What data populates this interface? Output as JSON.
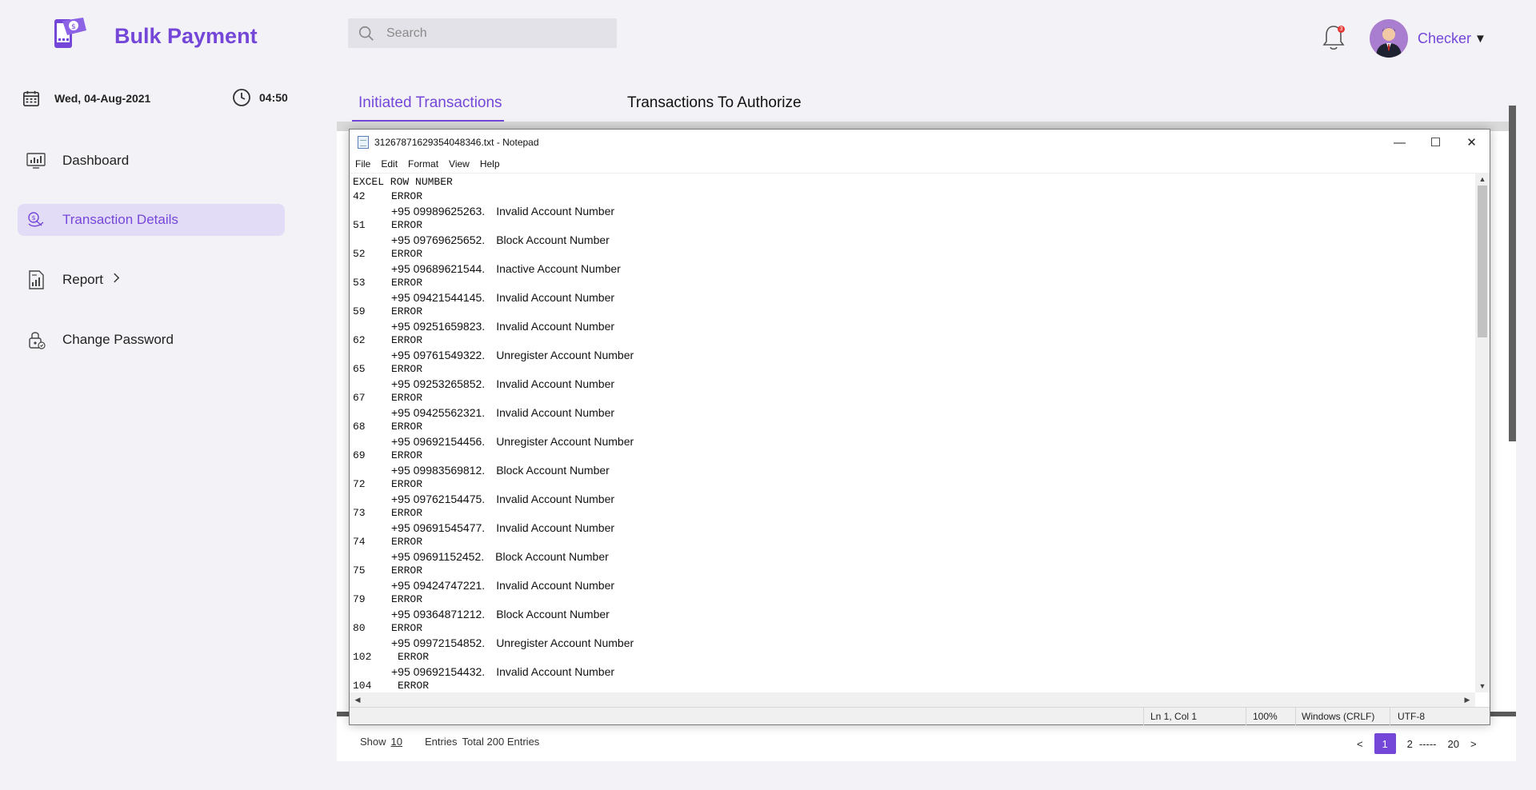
{
  "header": {
    "app_title": "Bulk Payment",
    "search_placeholder": "Search",
    "notification_count": "3",
    "user_name": "Checker"
  },
  "sidebar": {
    "date": "Wed, 04-Aug-2021",
    "time": "04:50",
    "items": [
      {
        "label": "Dashboard",
        "icon": "dashboard-icon"
      },
      {
        "label": "Transaction Details",
        "icon": "transaction-icon",
        "active": true
      },
      {
        "label": "Report",
        "icon": "report-icon",
        "chevron": ">"
      },
      {
        "label": "Change Password",
        "icon": "lock-icon"
      }
    ]
  },
  "tabs": [
    {
      "label": "Initiated Transactions",
      "active": true
    },
    {
      "label": "Transactions To Authorize",
      "active": false
    }
  ],
  "footer": {
    "show_label": "Show",
    "show_value": "10",
    "entries_label": "Entries",
    "total_label": "Total 200 Entries",
    "pager": {
      "prev": "<",
      "current": "1",
      "next_page": "2",
      "ellipsis": "-----",
      "last": "20",
      "next": ">"
    }
  },
  "notepad": {
    "title": "31267871629354048346.txt - Notepad",
    "menu": [
      "File",
      "Edit",
      "Format",
      "View",
      "Help"
    ],
    "header_line": "EXCEL ROW NUMBER",
    "rows": [
      {
        "row": "42",
        "status": "ERROR",
        "phone": "+95 09989625263.",
        "message": "Invalid Account Number"
      },
      {
        "row": "51",
        "status": "ERROR",
        "phone": "+95 09769625652.",
        "message": "Block Account Number"
      },
      {
        "row": "52",
        "status": "ERROR",
        "phone": "+95 09689621544.",
        "message": "Inactive Account Number"
      },
      {
        "row": "53",
        "status": "ERROR",
        "phone": "+95 09421544145.",
        "message": "Invalid Account Number"
      },
      {
        "row": "59",
        "status": "ERROR",
        "phone": "+95 09251659823.",
        "message": "Invalid Account Number"
      },
      {
        "row": "62",
        "status": "ERROR",
        "phone": "+95 09761549322.",
        "message": "Unregister Account Number"
      },
      {
        "row": "65",
        "status": "ERROR",
        "phone": "+95 09253265852.",
        "message": "Invalid Account Number"
      },
      {
        "row": "67",
        "status": "ERROR",
        "phone": "+95 09425562321.",
        "message": "Invalid Account Number"
      },
      {
        "row": "68",
        "status": "ERROR",
        "phone": "+95 09692154456.",
        "message": "Unregister Account Number"
      },
      {
        "row": "69",
        "status": "ERROR",
        "phone": "+95 09983569812.",
        "message": "Block Account Number"
      },
      {
        "row": "72",
        "status": "ERROR",
        "phone": "+95 09762154475.",
        "message": "Invalid Account Number"
      },
      {
        "row": "73",
        "status": "ERROR",
        "phone": "+95 09691545477.",
        "message": "Invalid Account Number"
      },
      {
        "row": "74",
        "status": "ERROR",
        "phone": "+95 09691152452.",
        "message": "Block Account Number"
      },
      {
        "row": "75",
        "status": "ERROR",
        "phone": "+95 09424747221.",
        "message": "Invalid Account Number"
      },
      {
        "row": "79",
        "status": "ERROR",
        "phone": "+95 09364871212.",
        "message": "Block Account Number"
      },
      {
        "row": "80",
        "status": "ERROR",
        "phone": "+95 09972154852.",
        "message": "Unregister Account Number"
      },
      {
        "row": "102",
        "status": "ERROR",
        "phone": "+95 09692154432.",
        "message": "Invalid Account Number"
      },
      {
        "row": "104",
        "status": "ERROR",
        "phone": "",
        "message": ""
      }
    ],
    "status_bar": {
      "position": "Ln 1, Col 1",
      "zoom": "100%",
      "line_ending": "Windows (CRLF)",
      "encoding": "UTF-8"
    }
  },
  "colors": {
    "accent": "#7447d9",
    "active_bg": "#e3dcf6",
    "badge": "#e53935"
  }
}
